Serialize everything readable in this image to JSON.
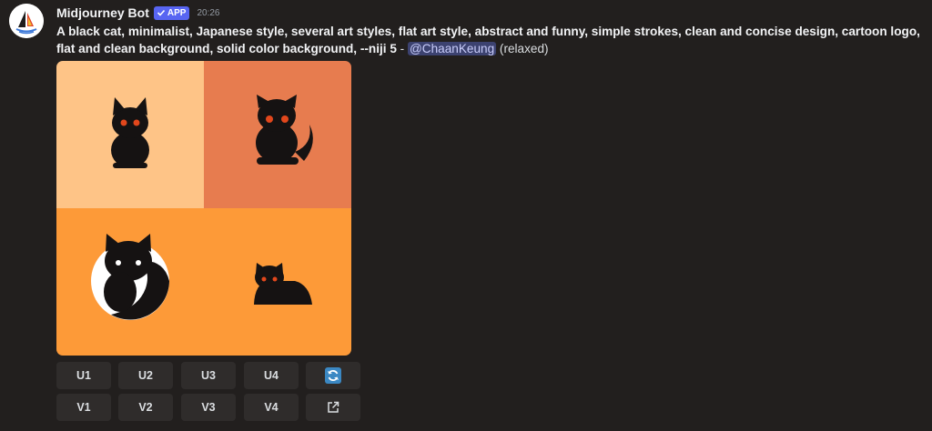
{
  "message": {
    "author": "Midjourney Bot",
    "badge": "APP",
    "timestamp": "20:26",
    "prompt_line1": "A black cat, minimalist, Japanese style, several art styles, flat art style, abstract and funny, simple strokes, clean and concise design, cartoon logo,",
    "prompt_line2": "flat and clean background, solid color background, --niji 5",
    "separator": " - ",
    "mention": "@ChaanKeung",
    "mode": "(relaxed)"
  },
  "image_grid": {
    "colors": {
      "top_left_bg": "#fec487",
      "top_right_bg": "#e77c4f",
      "bottom_bg": "#fd9a38",
      "cat": "#151212",
      "eye": "#e2471c",
      "circle": "#ffffff"
    }
  },
  "buttons": {
    "upscale": [
      "U1",
      "U2",
      "U3",
      "U4"
    ],
    "variation": [
      "V1",
      "V2",
      "V3",
      "V4"
    ],
    "reroll_icon": "refresh-icon",
    "open_icon": "external-link-icon"
  }
}
